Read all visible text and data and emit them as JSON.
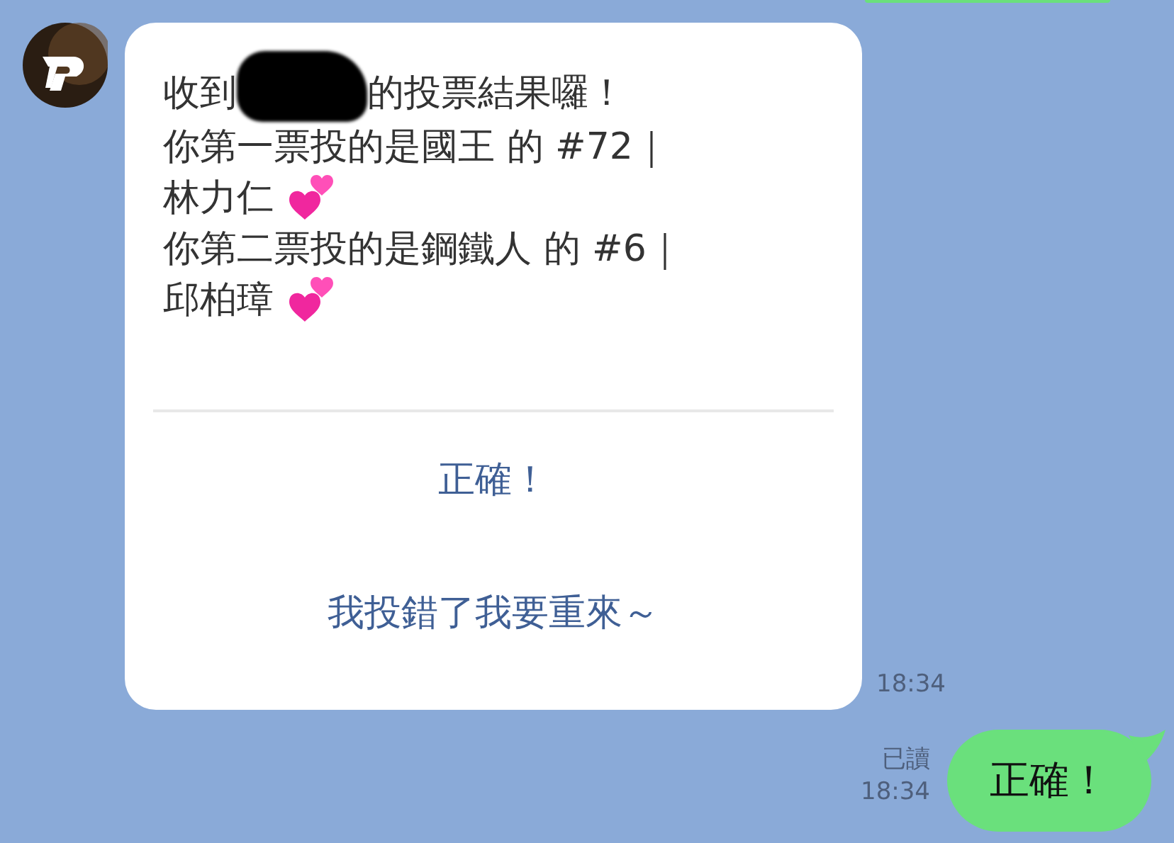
{
  "incoming": {
    "lines": [
      {
        "kind": "redacted",
        "before": "收到",
        "after": "的投票結果囉！"
      },
      {
        "kind": "text",
        "text": "你第一票投的是國王 的 #72｜"
      },
      {
        "kind": "hearts",
        "text": "林力仁"
      },
      {
        "kind": "text",
        "text": "你第二票投的是鋼鐵人 的 #6｜"
      },
      {
        "kind": "hearts",
        "text": "邱柏璋"
      }
    ],
    "actions": [
      "正確！",
      "我投錯了我要重來～"
    ],
    "time": "18:34"
  },
  "outgoing": {
    "read": "已讀",
    "time": "18:34",
    "text": "正確！"
  }
}
